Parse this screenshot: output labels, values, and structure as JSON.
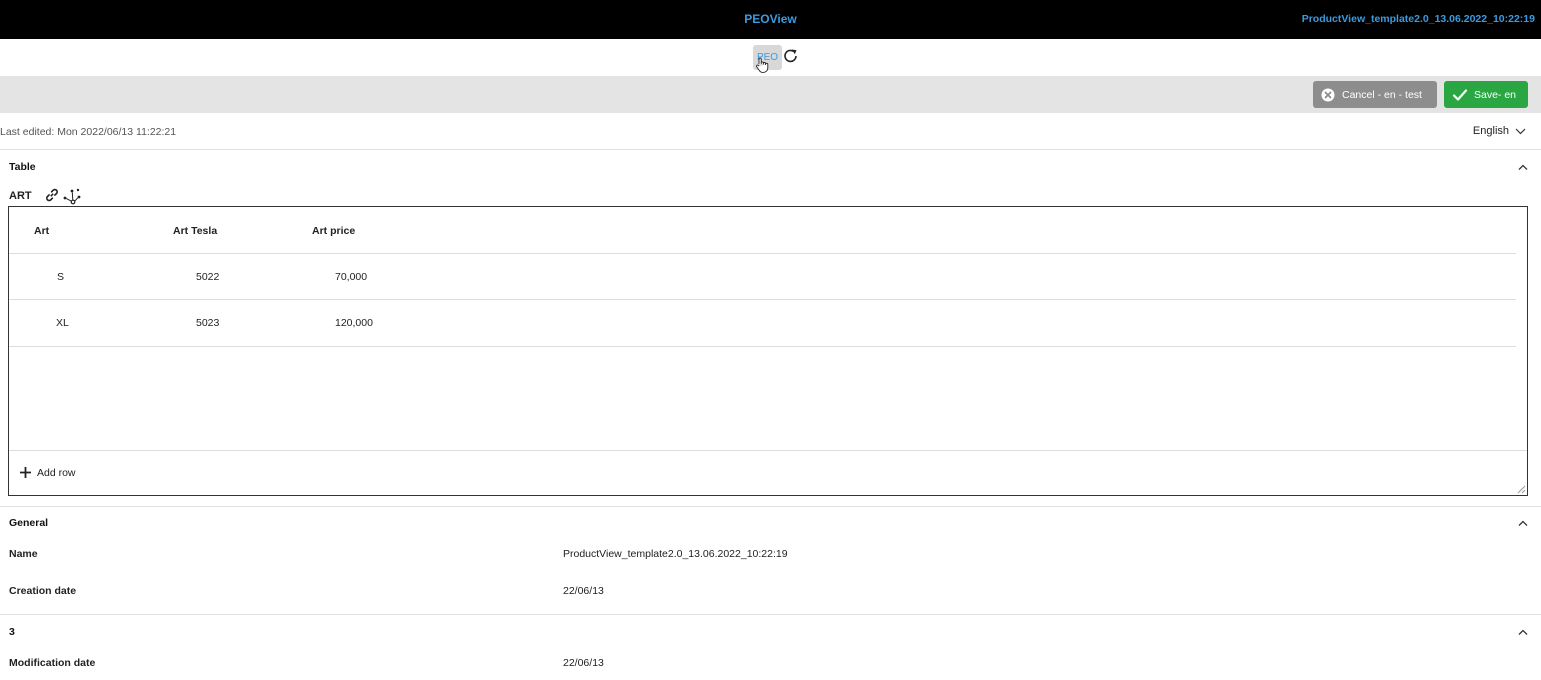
{
  "topbar": {
    "app_title": "PEOView",
    "doc_title": "ProductView_template2.0_13.06.2022_10:22:19"
  },
  "iconbar": {
    "peo_label": "PEO"
  },
  "actions": {
    "cancel_label": "Cancel - en - test",
    "save_label": "Save- en"
  },
  "meta": {
    "last_edited": "Last edited: Mon 2022/06/13 11:22:21",
    "language": "English"
  },
  "table_section": {
    "title": "Table",
    "table_label": "ART",
    "columns": [
      "Art",
      "Art Tesla",
      "Art price"
    ],
    "rows": [
      [
        "S",
        "5022",
        "70,000"
      ],
      [
        "XL",
        "5023",
        "120,000"
      ]
    ],
    "add_row_label": "Add row"
  },
  "general_section": {
    "title": "General",
    "name_label": "Name",
    "name_value": "ProductView_template2.0_13.06.2022_10:22:19",
    "creation_label": "Creation date",
    "creation_value": "22/06/13"
  },
  "section_3": {
    "title": "3",
    "modification_label": "Modification date",
    "modification_value": "22/06/13"
  },
  "colors": {
    "topbar_bg": "#000000",
    "accent_blue": "#3a9be0",
    "save_green": "#2aa743",
    "cancel_gray": "#8d8d8d"
  }
}
